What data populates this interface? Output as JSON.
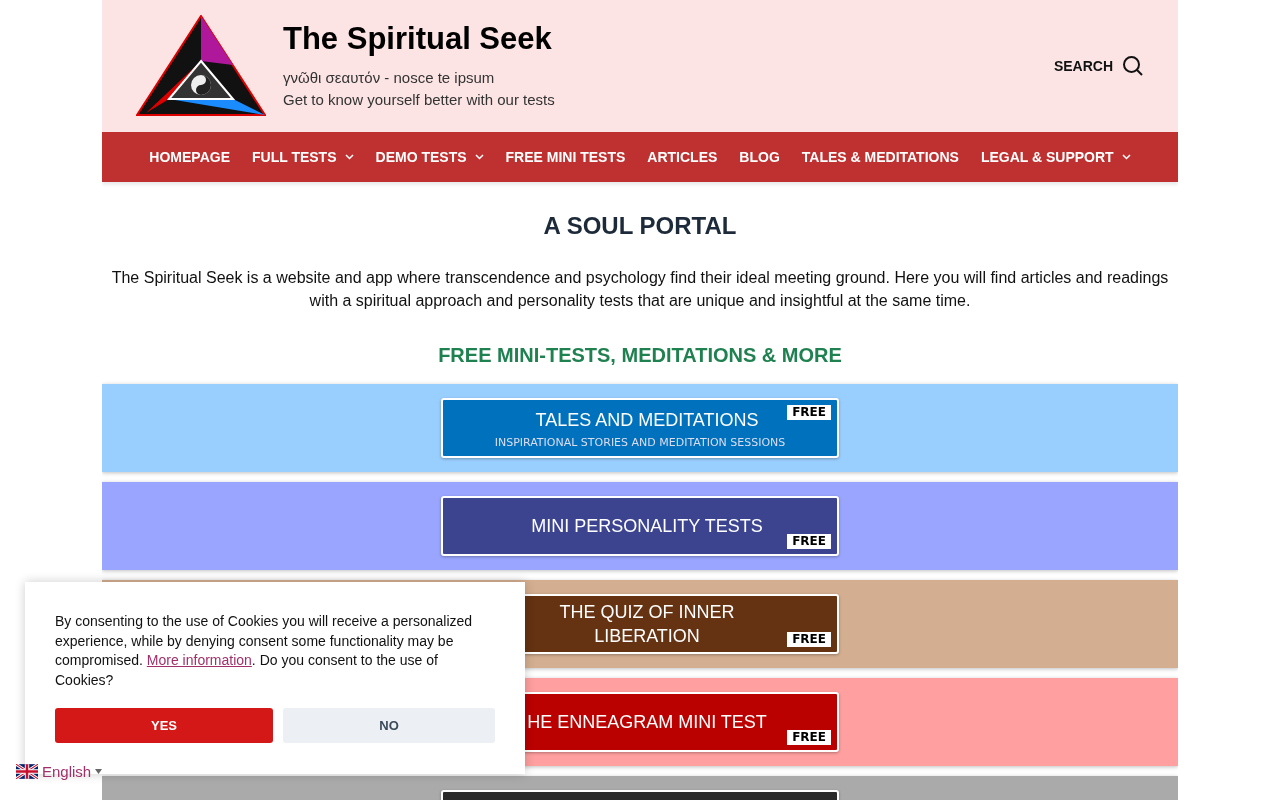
{
  "site": {
    "title": "The Spiritual Seek",
    "motto": "γνῶθι σεαυτόν - nosce te ipsum",
    "tagline": "Get to know yourself better with our tests",
    "search_label": "SEARCH"
  },
  "nav": [
    {
      "label": "HOMEPAGE",
      "dropdown": false
    },
    {
      "label": "FULL TESTS",
      "dropdown": true
    },
    {
      "label": "DEMO TESTS",
      "dropdown": true
    },
    {
      "label": "FREE MINI TESTS",
      "dropdown": false
    },
    {
      "label": "ARTICLES",
      "dropdown": false
    },
    {
      "label": "BLOG",
      "dropdown": false
    },
    {
      "label": "TALES & MEDITATIONS",
      "dropdown": false
    },
    {
      "label": "LEGAL & SUPPORT",
      "dropdown": true
    }
  ],
  "heading": "A SOUL PORTAL",
  "intro": "The Spiritual Seek is a website and app where transcendence and psychology find their ideal meeting ground. Here you will find articles and readings with a spiritual approach and personality tests that are unique and insightful at the same time.",
  "section_heading": "FREE MINI-TESTS, MEDITATIONS & MORE",
  "banners": [
    {
      "color": "#99cfff",
      "button": {
        "title": "TALES AND MEDITATIONS",
        "subtitle": "INSPIRATIONAL STORIES AND MEDITATION SESSIONS",
        "badge": "FREE",
        "color": "#0071bc"
      }
    },
    {
      "color": "#9aa5ff",
      "button": {
        "title": "MINI PERSONALITY TESTS",
        "badge": "FREE",
        "color": "#3c4490"
      }
    },
    {
      "color": "#d4ae90",
      "button": {
        "title": "THE QUIZ OF INNER LIBERATION",
        "badge": "FREE",
        "color": "#653212"
      }
    },
    {
      "color": "#ff9f9f",
      "button": {
        "title": "HE ENNEAGRAM MINI TEST",
        "badge": "FREE",
        "color": "#bb0000"
      }
    },
    {
      "color": "#aaaaaa",
      "button": {
        "color": "#2b2b2b"
      }
    }
  ],
  "cookie": {
    "text_before": "By consenting to the use of Cookies you will receive a personalized experience, while by denying consent some functionality may be compromised.",
    "link": "More information",
    "text_after": ". Do you consent to the use of Cookies?",
    "accept": "YES",
    "decline": "NO"
  },
  "language": {
    "label": "English"
  }
}
